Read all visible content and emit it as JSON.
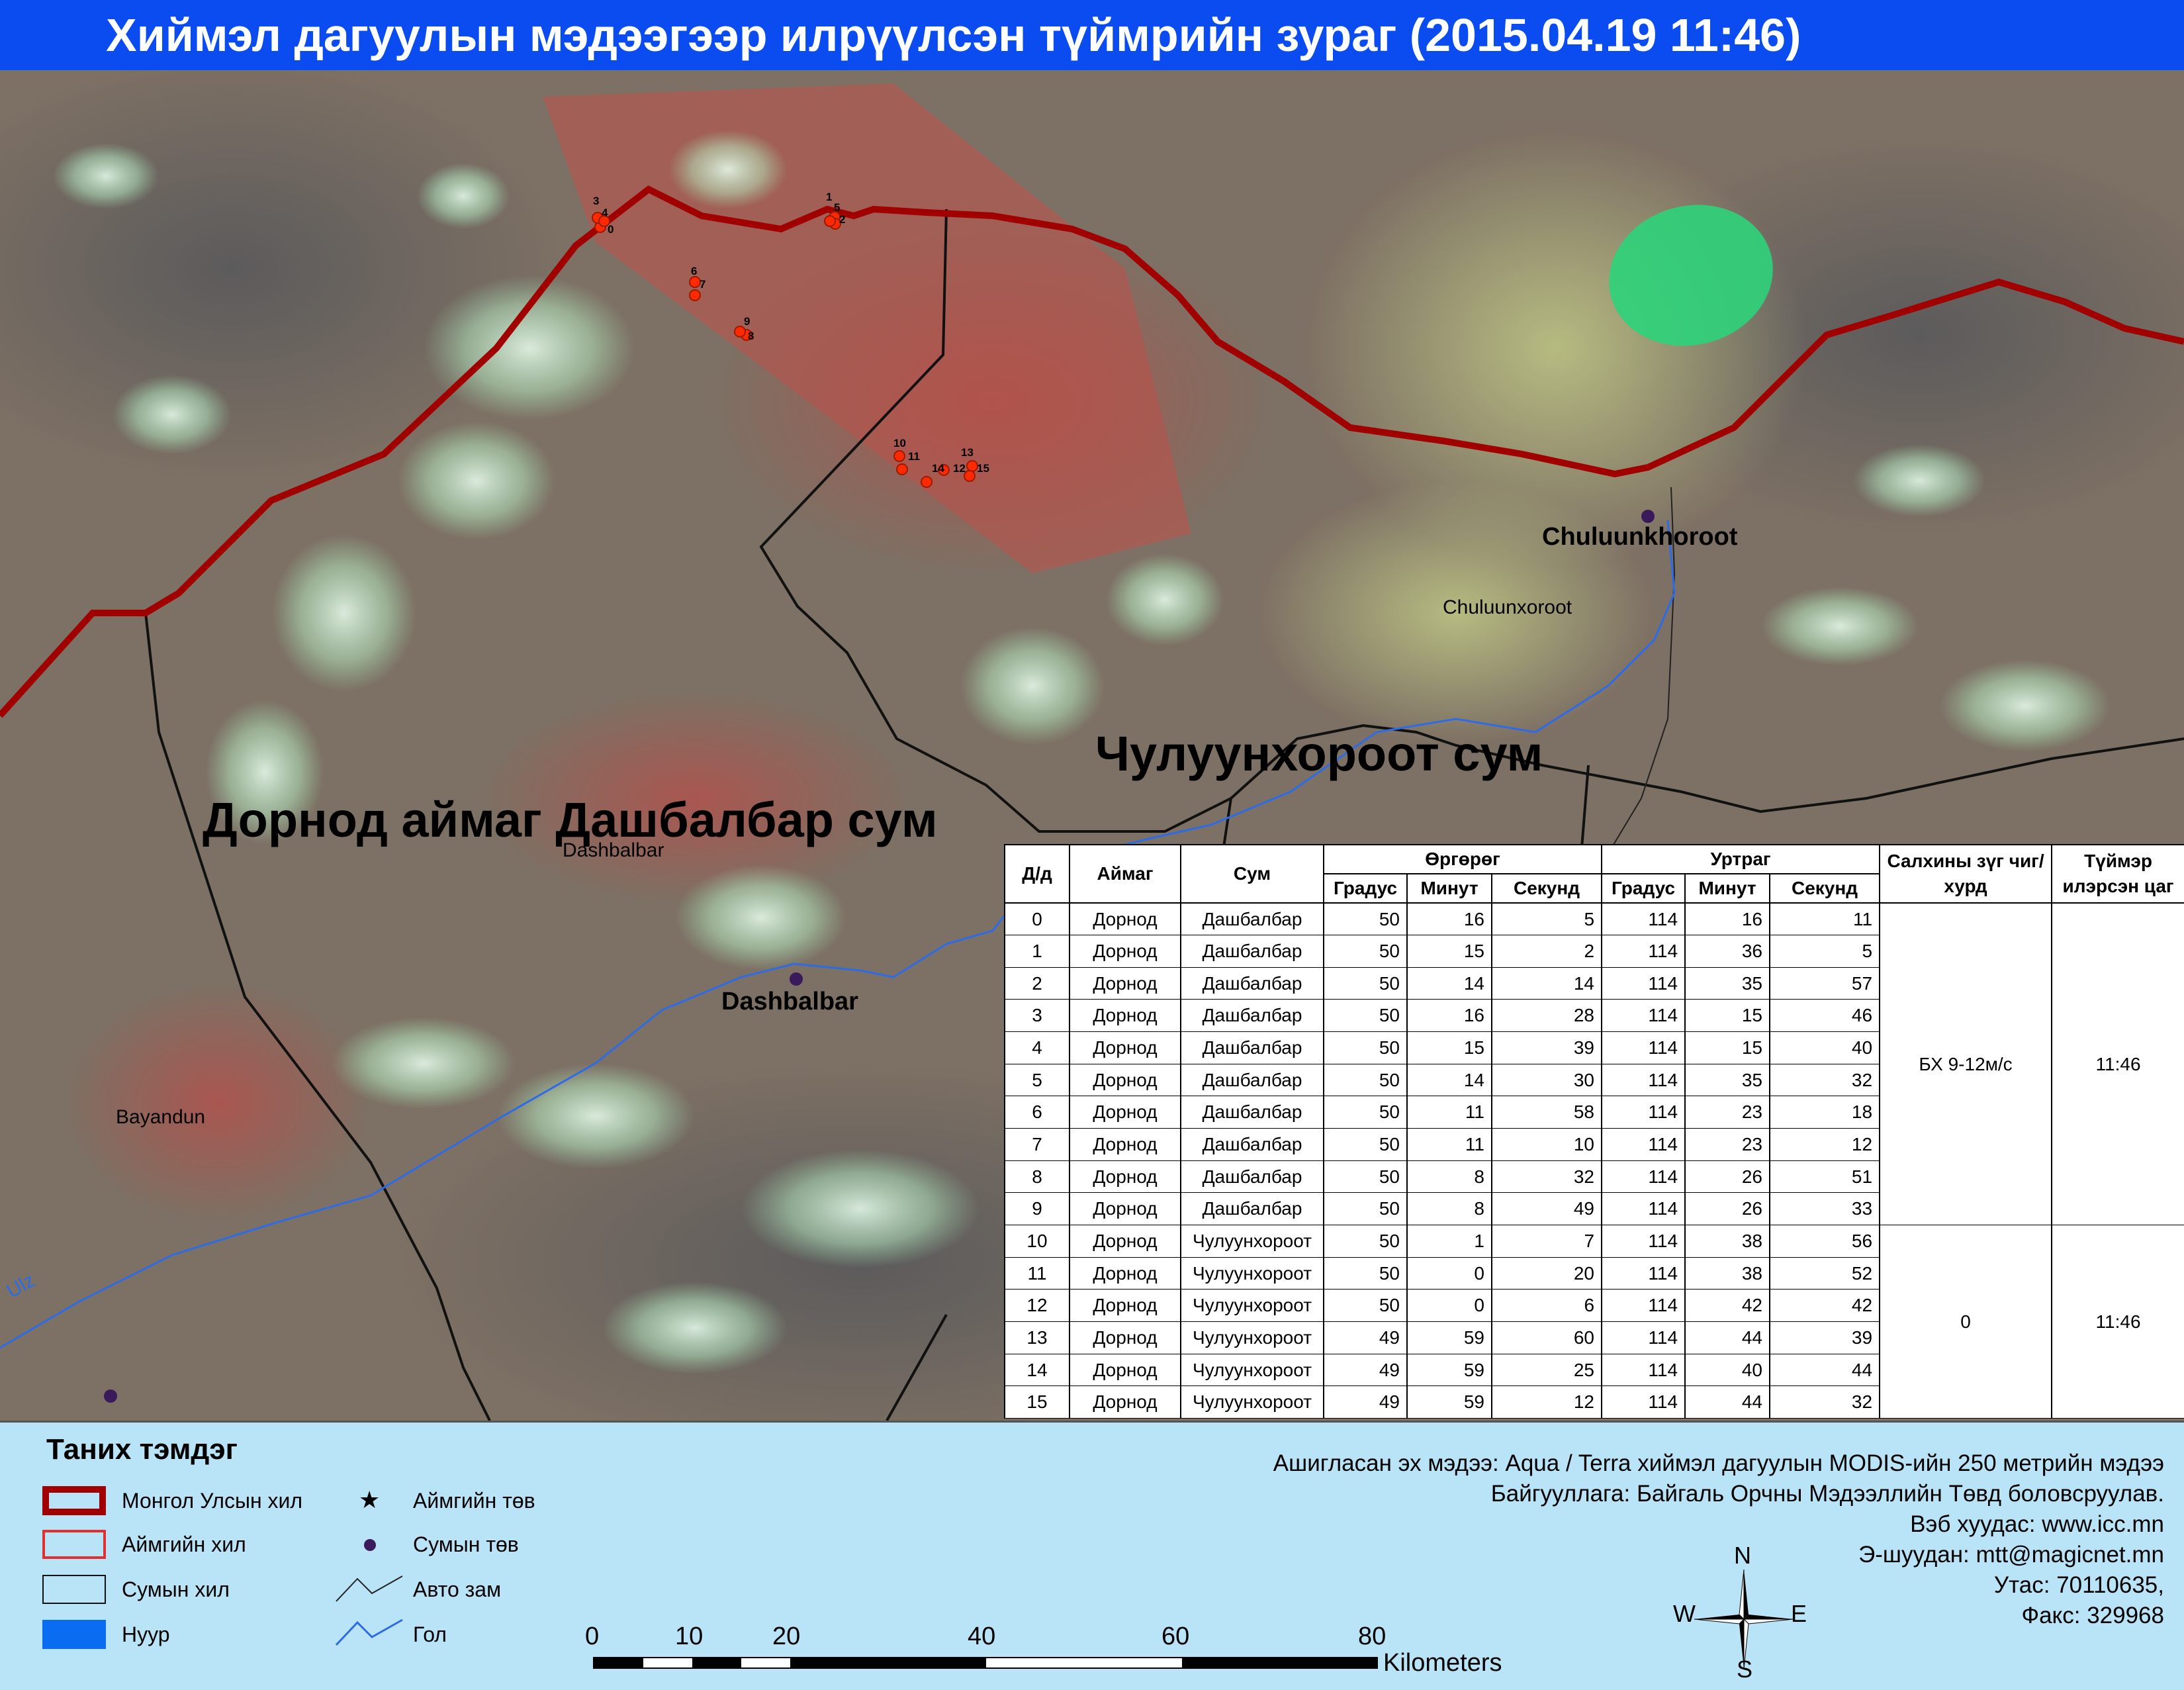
{
  "title": "Хиймэл дагуулын мэдээгээр илрүүлсэн түймрийн зураг  (2015.04.19 11:46)",
  "map": {
    "labels": {
      "dornod_dashbalbar": "Дорнод аймаг Дашбалбар сум",
      "chuluunkhoroot_sum": "Чулуунхороот сум",
      "chuluunkhoroot_center": "Chuluunkhoroot",
      "chuluunxoroot_area": "Chuluunxoroot",
      "dashbalbar_center": "Dashbalbar",
      "dashbalbar_area": "Dashbalbar",
      "bayandun": "Bayandun",
      "river_ulz": "Ulz"
    },
    "colors": {
      "national_border": "#a00000",
      "aimag_border": "#e03030",
      "sum_border": "#111111",
      "river": "#2e6be6",
      "lake": "#2ed37a",
      "fire": "#ff2a00",
      "sum_center": "#3b1a5c"
    },
    "fire_numbers": [
      "0",
      "1",
      "2",
      "3",
      "4",
      "5",
      "6",
      "7",
      "8",
      "9",
      "10",
      "11",
      "12",
      "13",
      "14",
      "15"
    ]
  },
  "table": {
    "headers": {
      "dd": "Д/д",
      "aimag": "Аймаг",
      "sum": "Сум",
      "latitude": "Өргөрөг",
      "longitude": "Уртраг",
      "degree": "Градус",
      "minute": "Минут",
      "second": "Секунд",
      "wind": "Салхины зүг чиг/хурд",
      "detected": "Түймэр илэрсэн цаг"
    },
    "rows": [
      {
        "dd": "0",
        "aimag": "Дорнод",
        "sum": "Дашбалбар",
        "lat_d": "50",
        "lat_m": "16",
        "lat_s": "5",
        "lon_d": "114",
        "lon_m": "16",
        "lon_s": "11"
      },
      {
        "dd": "1",
        "aimag": "Дорнод",
        "sum": "Дашбалбар",
        "lat_d": "50",
        "lat_m": "15",
        "lat_s": "2",
        "lon_d": "114",
        "lon_m": "36",
        "lon_s": "5"
      },
      {
        "dd": "2",
        "aimag": "Дорнод",
        "sum": "Дашбалбар",
        "lat_d": "50",
        "lat_m": "14",
        "lat_s": "14",
        "lon_d": "114",
        "lon_m": "35",
        "lon_s": "57"
      },
      {
        "dd": "3",
        "aimag": "Дорнод",
        "sum": "Дашбалбар",
        "lat_d": "50",
        "lat_m": "16",
        "lat_s": "28",
        "lon_d": "114",
        "lon_m": "15",
        "lon_s": "46"
      },
      {
        "dd": "4",
        "aimag": "Дорнод",
        "sum": "Дашбалбар",
        "lat_d": "50",
        "lat_m": "15",
        "lat_s": "39",
        "lon_d": "114",
        "lon_m": "15",
        "lon_s": "40"
      },
      {
        "dd": "5",
        "aimag": "Дорнод",
        "sum": "Дашбалбар",
        "lat_d": "50",
        "lat_m": "14",
        "lat_s": "30",
        "lon_d": "114",
        "lon_m": "35",
        "lon_s": "32"
      },
      {
        "dd": "6",
        "aimag": "Дорнод",
        "sum": "Дашбалбар",
        "lat_d": "50",
        "lat_m": "11",
        "lat_s": "58",
        "lon_d": "114",
        "lon_m": "23",
        "lon_s": "18"
      },
      {
        "dd": "7",
        "aimag": "Дорнод",
        "sum": "Дашбалбар",
        "lat_d": "50",
        "lat_m": "11",
        "lat_s": "10",
        "lon_d": "114",
        "lon_m": "23",
        "lon_s": "12"
      },
      {
        "dd": "8",
        "aimag": "Дорнод",
        "sum": "Дашбалбар",
        "lat_d": "50",
        "lat_m": "8",
        "lat_s": "32",
        "lon_d": "114",
        "lon_m": "26",
        "lon_s": "51"
      },
      {
        "dd": "9",
        "aimag": "Дорнод",
        "sum": "Дашбалбар",
        "lat_d": "50",
        "lat_m": "8",
        "lat_s": "49",
        "lon_d": "114",
        "lon_m": "26",
        "lon_s": "33"
      },
      {
        "dd": "10",
        "aimag": "Дорнод",
        "sum": "Чулуунхороот",
        "lat_d": "50",
        "lat_m": "1",
        "lat_s": "7",
        "lon_d": "114",
        "lon_m": "38",
        "lon_s": "56"
      },
      {
        "dd": "11",
        "aimag": "Дорнод",
        "sum": "Чулуунхороот",
        "lat_d": "50",
        "lat_m": "0",
        "lat_s": "20",
        "lon_d": "114",
        "lon_m": "38",
        "lon_s": "52"
      },
      {
        "dd": "12",
        "aimag": "Дорнод",
        "sum": "Чулуунхороот",
        "lat_d": "50",
        "lat_m": "0",
        "lat_s": "6",
        "lon_d": "114",
        "lon_m": "42",
        "lon_s": "42"
      },
      {
        "dd": "13",
        "aimag": "Дорнод",
        "sum": "Чулуунхороот",
        "lat_d": "49",
        "lat_m": "59",
        "lat_s": "60",
        "lon_d": "114",
        "lon_m": "44",
        "lon_s": "39"
      },
      {
        "dd": "14",
        "aimag": "Дорнод",
        "sum": "Чулуунхороот",
        "lat_d": "49",
        "lat_m": "59",
        "lat_s": "25",
        "lon_d": "114",
        "lon_m": "40",
        "lon_s": "44"
      },
      {
        "dd": "15",
        "aimag": "Дорнод",
        "sum": "Чулуунхороот",
        "lat_d": "49",
        "lat_m": "59",
        "lat_s": "12",
        "lon_d": "114",
        "lon_m": "44",
        "lon_s": "32"
      }
    ],
    "group1": {
      "wind": "БХ 9-12м/с",
      "time": "11:46"
    },
    "group2": {
      "wind": "0",
      "time": "11:46"
    }
  },
  "legend": {
    "title": "Таних тэмдэг",
    "items": {
      "national_border": "Монгол Улсын хил",
      "aimag_border": "Аймгийн хил",
      "sum_border": "Сумын хил",
      "lake": "Нуур",
      "aimag_center": "Аймгийн төв",
      "sum_center": "Сумын төв",
      "road": "Авто зам",
      "river": "Гол"
    }
  },
  "scale": {
    "ticks": [
      "0",
      "10",
      "20",
      "40",
      "60",
      "80"
    ],
    "unit": "Kilometers"
  },
  "compass": {
    "n": "N",
    "s": "S",
    "e": "E",
    "w": "W"
  },
  "info": {
    "source": "Ашигласан эх мэдээ: Aqua / Terra хиймэл дагуулын MODIS-ийн 250 метрийн мэдээ",
    "org": "Байгууллага: Байгаль Орчны Мэдээллийн Төвд боловсруулав.",
    "web": "Вэб хуудас: www.icc.mn",
    "email": "Э-шуудан: mtt@magicnet.mn",
    "phone": "Утас: 70110635,",
    "fax": "Факс: 329968"
  }
}
